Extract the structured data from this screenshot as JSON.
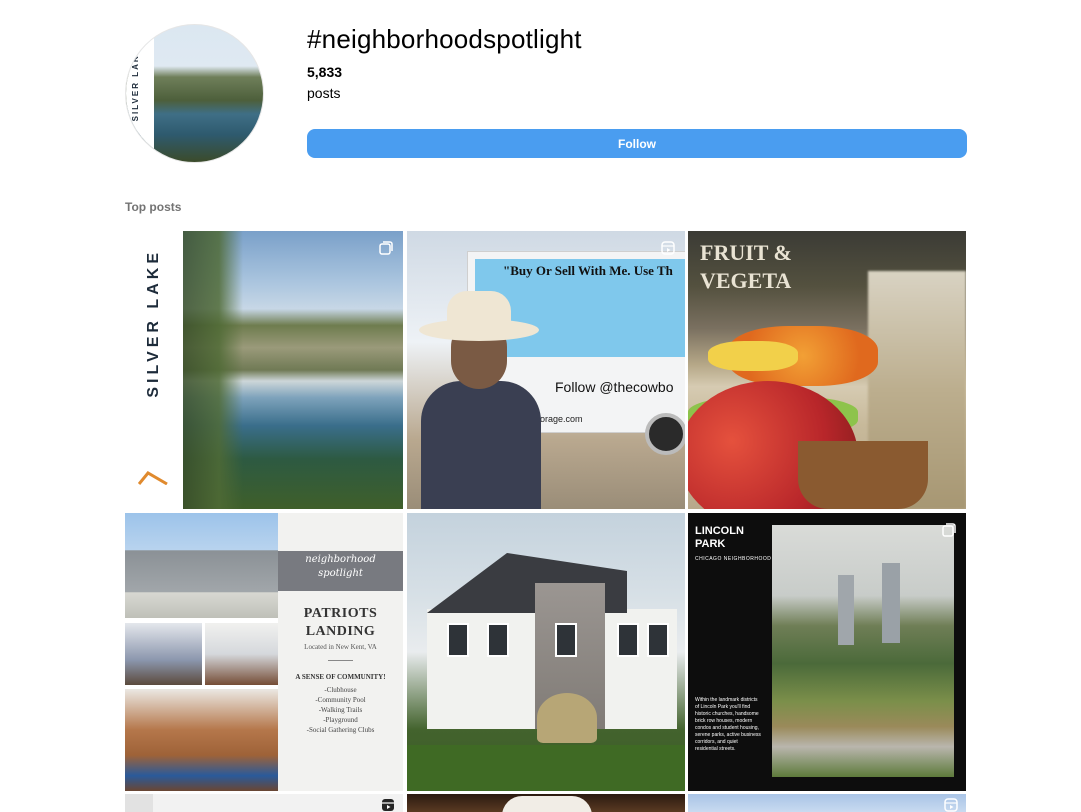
{
  "header": {
    "hashtag": "#neighborhoodspotlight",
    "post_count": "5,833",
    "posts_label": "posts",
    "follow_label": "Follow",
    "avatar_text": "SILVER LAKE"
  },
  "section_title": "Top posts",
  "posts": {
    "p1": {
      "vertical_text": "SILVER LAKE",
      "icon": "carousel-icon"
    },
    "p2": {
      "banner_text": "\"Buy Or Sell With Me. Use Th",
      "follow_text": "Follow @thecowbo",
      "site_text": "orage.com",
      "icon": "reel-icon"
    },
    "p3": {
      "sign_line1": "FRUIT &",
      "sign_line2": "VEGETA"
    },
    "p4": {
      "script_line1": "neighborhood",
      "script_line2": "spotlight",
      "title_line1": "PATRIOTS",
      "title_line2": "LANDING",
      "subtitle": "Located in New Kent, VA",
      "headline": "A SENSE OF COMMUNITY!",
      "features": [
        "-Clubhouse",
        "-Community Pool",
        "-Walking Trails",
        "-Playground",
        "-Social Gathering Clubs"
      ]
    },
    "p6": {
      "name_line1": "LINCOLN",
      "name_line2": "PARK",
      "subtitle": "CHICAGO NEIGHBORHOOD",
      "body": "Within the landmark districts of Lincoln Park you'll find historic churches, handsome brick row houses, modern condos and student housing, serene parks, active business corridors, and quiet residential streets.",
      "icon": "carousel-icon"
    },
    "bottom_icons": {
      "b1": "reel-icon",
      "b3": "reel-icon"
    }
  },
  "colors": {
    "follow_button": "#4a9df0",
    "section_title": "#737373"
  }
}
